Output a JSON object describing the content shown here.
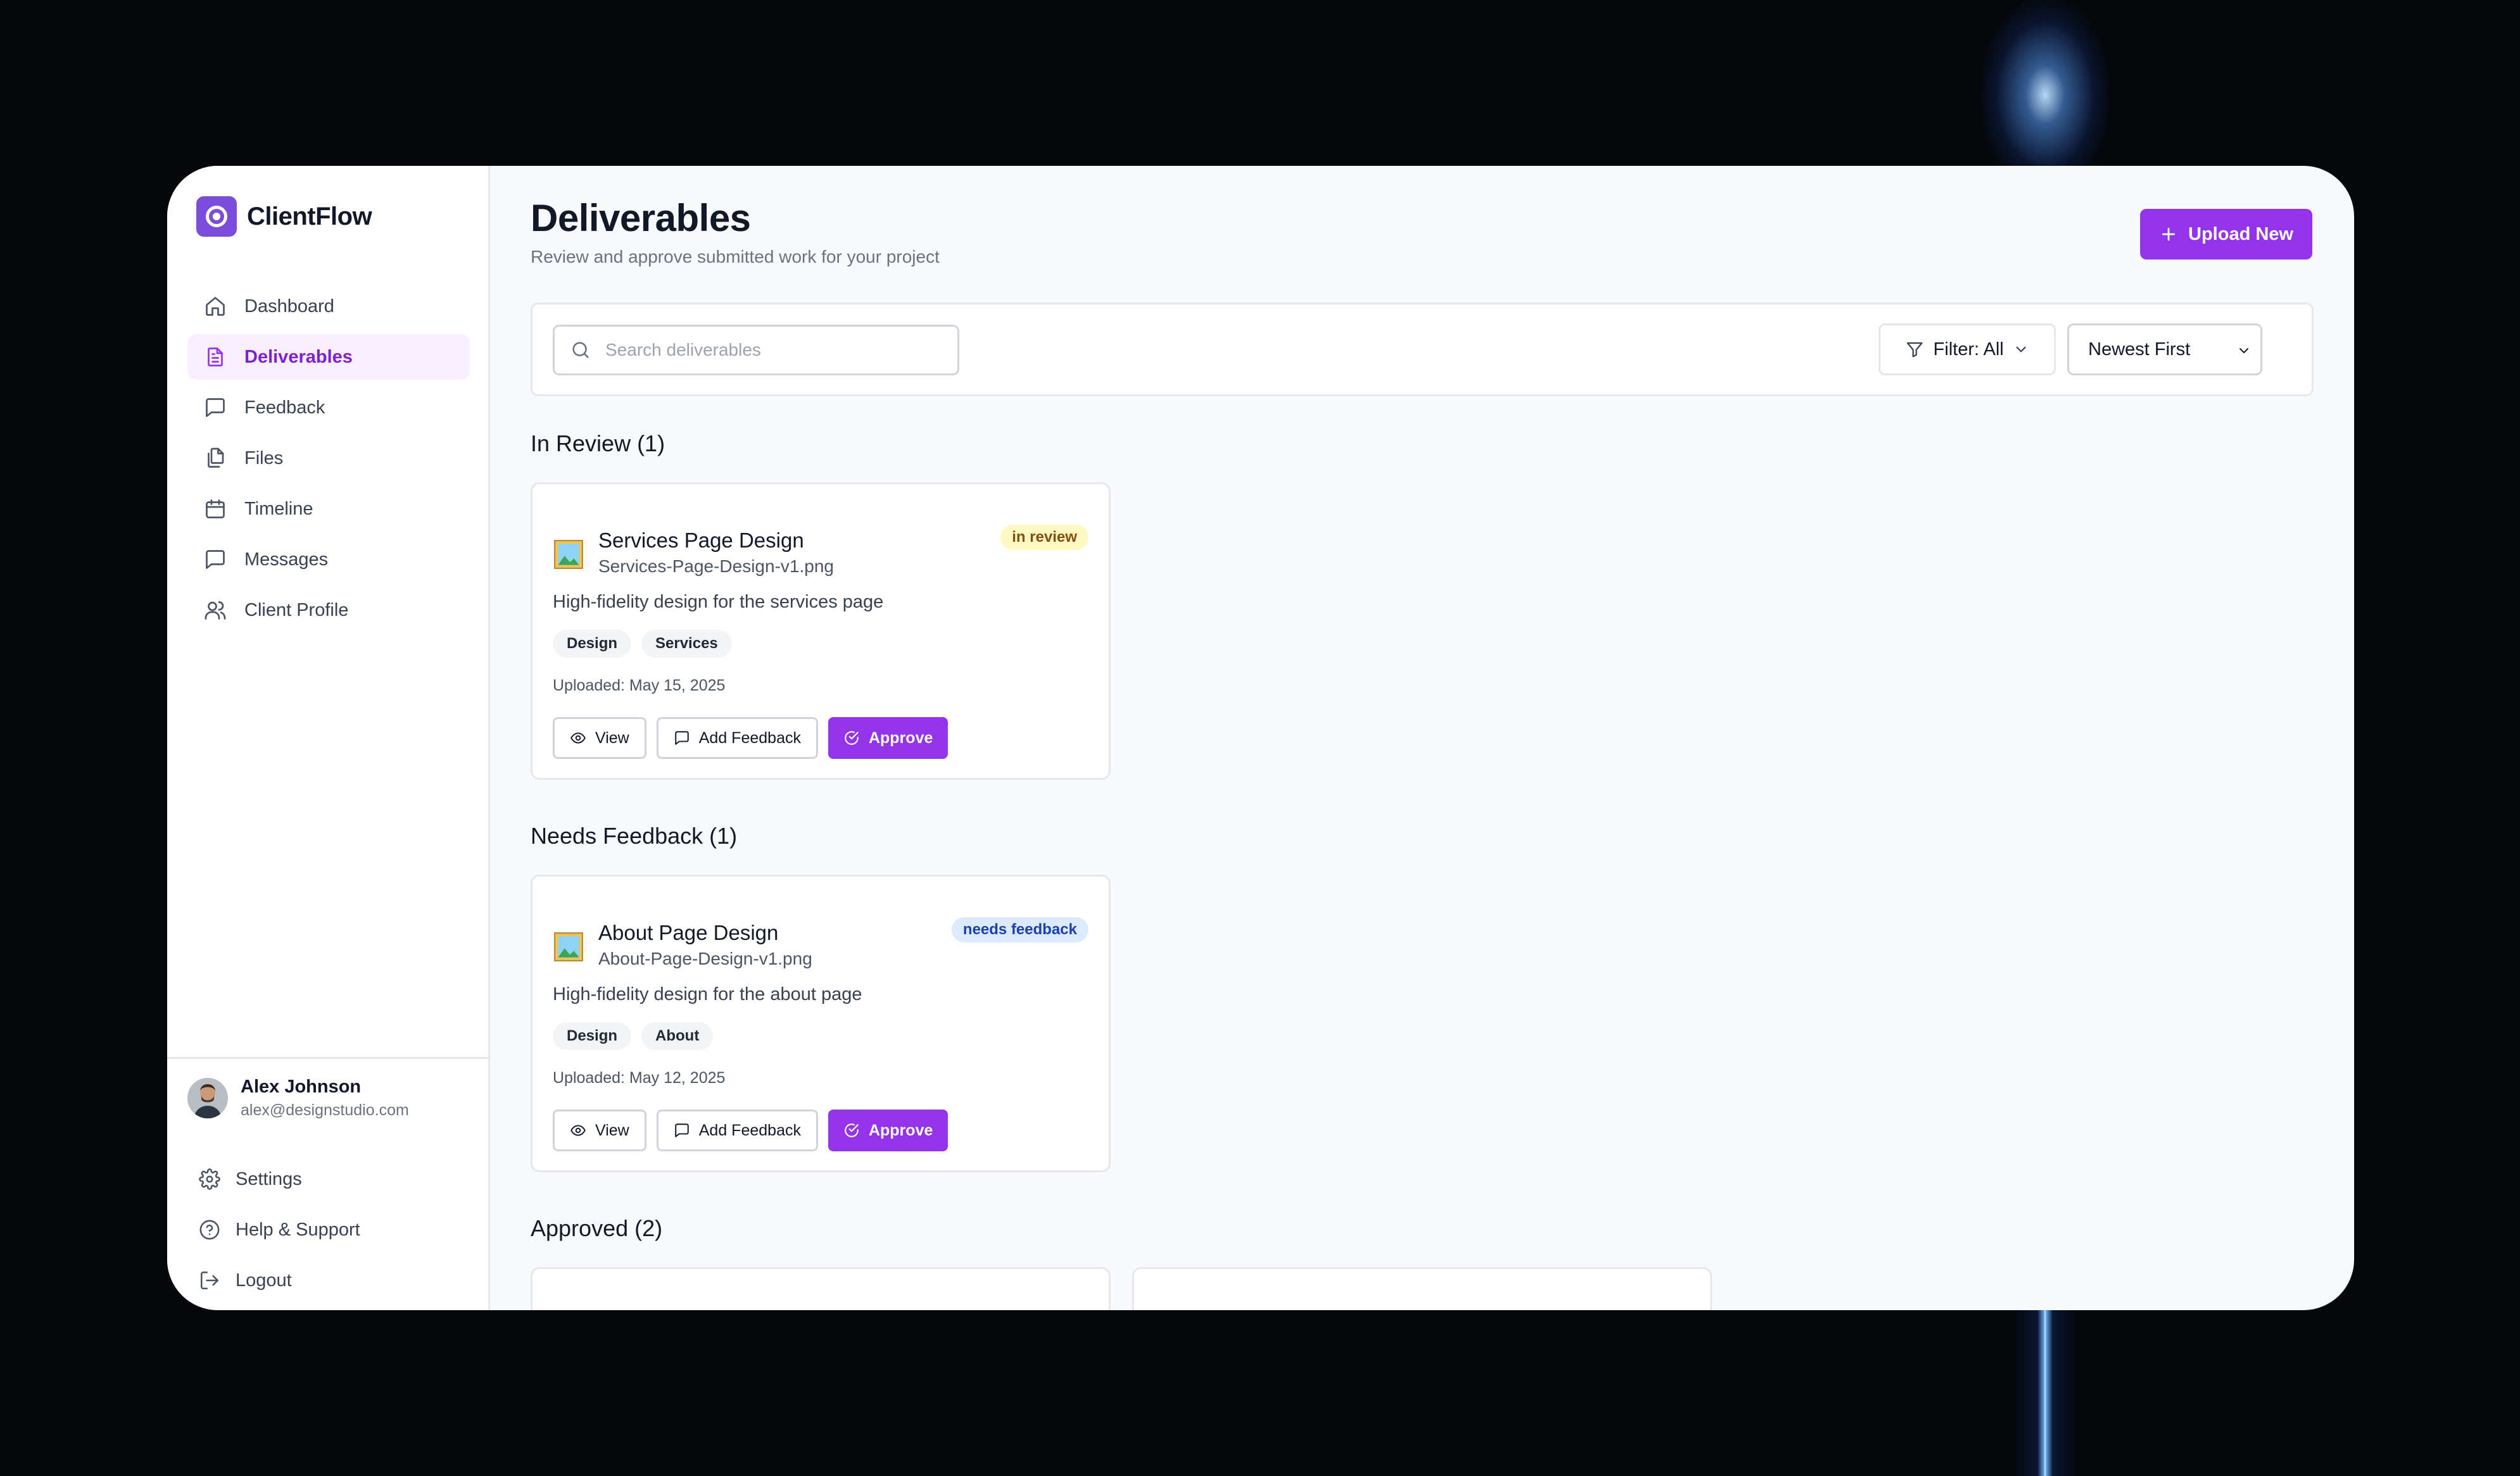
{
  "app": {
    "name": "ClientFlow"
  },
  "sidebar": {
    "items": [
      {
        "label": "Dashboard",
        "icon": "home-icon"
      },
      {
        "label": "Deliverables",
        "icon": "document-icon",
        "active": true
      },
      {
        "label": "Feedback",
        "icon": "message-square-icon"
      },
      {
        "label": "Files",
        "icon": "files-icon"
      },
      {
        "label": "Timeline",
        "icon": "calendar-icon"
      },
      {
        "label": "Messages",
        "icon": "message-icon"
      },
      {
        "label": "Client Profile",
        "icon": "users-icon"
      }
    ],
    "user": {
      "name": "Alex Johnson",
      "email": "alex@designstudio.com"
    },
    "footer_items": [
      {
        "label": "Settings",
        "icon": "gear-icon"
      },
      {
        "label": "Help & Support",
        "icon": "help-icon"
      },
      {
        "label": "Logout",
        "icon": "logout-icon"
      }
    ]
  },
  "header": {
    "title": "Deliverables",
    "subtitle": "Review and approve submitted work for your project",
    "upload_label": "Upload New"
  },
  "toolbar": {
    "search_placeholder": "Search deliverables",
    "filter_label": "Filter: All",
    "sort_value": "Newest First"
  },
  "sections": [
    {
      "title": "In Review (1)",
      "cards": [
        {
          "title": "Services Page Design",
          "file": "Services-Page-Design-v1.png",
          "status": "in review",
          "description": "High-fidelity design for the services page",
          "tags": [
            "Design",
            "Services"
          ],
          "uploaded": "Uploaded: May 15, 2025",
          "actions": {
            "view": "View",
            "feedback": "Add Feedback",
            "approve": "Approve"
          }
        }
      ]
    },
    {
      "title": "Needs Feedback (1)",
      "cards": [
        {
          "title": "About Page Design",
          "file": "About-Page-Design-v1.png",
          "status": "needs feedback",
          "description": "High-fidelity design for the about page",
          "tags": [
            "Design",
            "About"
          ],
          "uploaded": "Uploaded: May 12, 2025",
          "actions": {
            "view": "View",
            "feedback": "Add Feedback",
            "approve": "Approve"
          }
        }
      ]
    },
    {
      "title": "Approved (2)"
    }
  ],
  "colors": {
    "accent": "#9333ea",
    "brand_logo": "#7c4ddc",
    "active_nav_bg": "#f7eefe",
    "badge_review_bg": "#fef9c3",
    "badge_feedback_bg": "#dbeafe"
  }
}
